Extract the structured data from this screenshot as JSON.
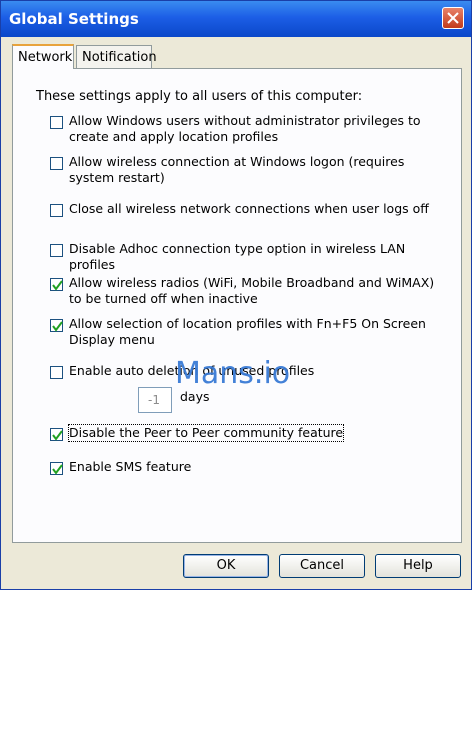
{
  "window": {
    "title": "Global Settings"
  },
  "tabs": [
    {
      "label": "Network",
      "active": true
    },
    {
      "label": "Notification",
      "active": false
    }
  ],
  "intro_text": "These settings apply to all users of this computer:",
  "options": [
    {
      "label": "Allow Windows users without administrator privileges to create and apply location profiles",
      "checked": false
    },
    {
      "label": "Allow wireless connection at Windows logon (requires system restart)",
      "checked": false
    },
    {
      "label": "Close all wireless network connections when user logs off",
      "checked": false
    },
    {
      "label": "Disable Adhoc connection type option in wireless LAN profiles",
      "checked": false
    },
    {
      "label": "Allow wireless radios (WiFi, Mobile Broadband and WiMAX) to be turned off when inactive",
      "checked": true
    },
    {
      "label": "Allow selection of location profiles with Fn+F5 On Screen Display menu",
      "checked": true
    },
    {
      "label": "Enable auto deletion of unused profiles",
      "checked": false
    },
    {
      "label": "Disable the Peer to Peer community feature",
      "checked": true
    },
    {
      "label": "Enable SMS feature",
      "checked": true
    }
  ],
  "auto_delete": {
    "days_value": "-1",
    "days_label": "days"
  },
  "buttons": {
    "ok": "OK",
    "cancel": "Cancel",
    "help": "Help"
  },
  "watermark": "Mans.io",
  "colors": {
    "titlebar": "#0a47c9",
    "dialog_bg": "#ece9d8",
    "check": "#21a121"
  }
}
